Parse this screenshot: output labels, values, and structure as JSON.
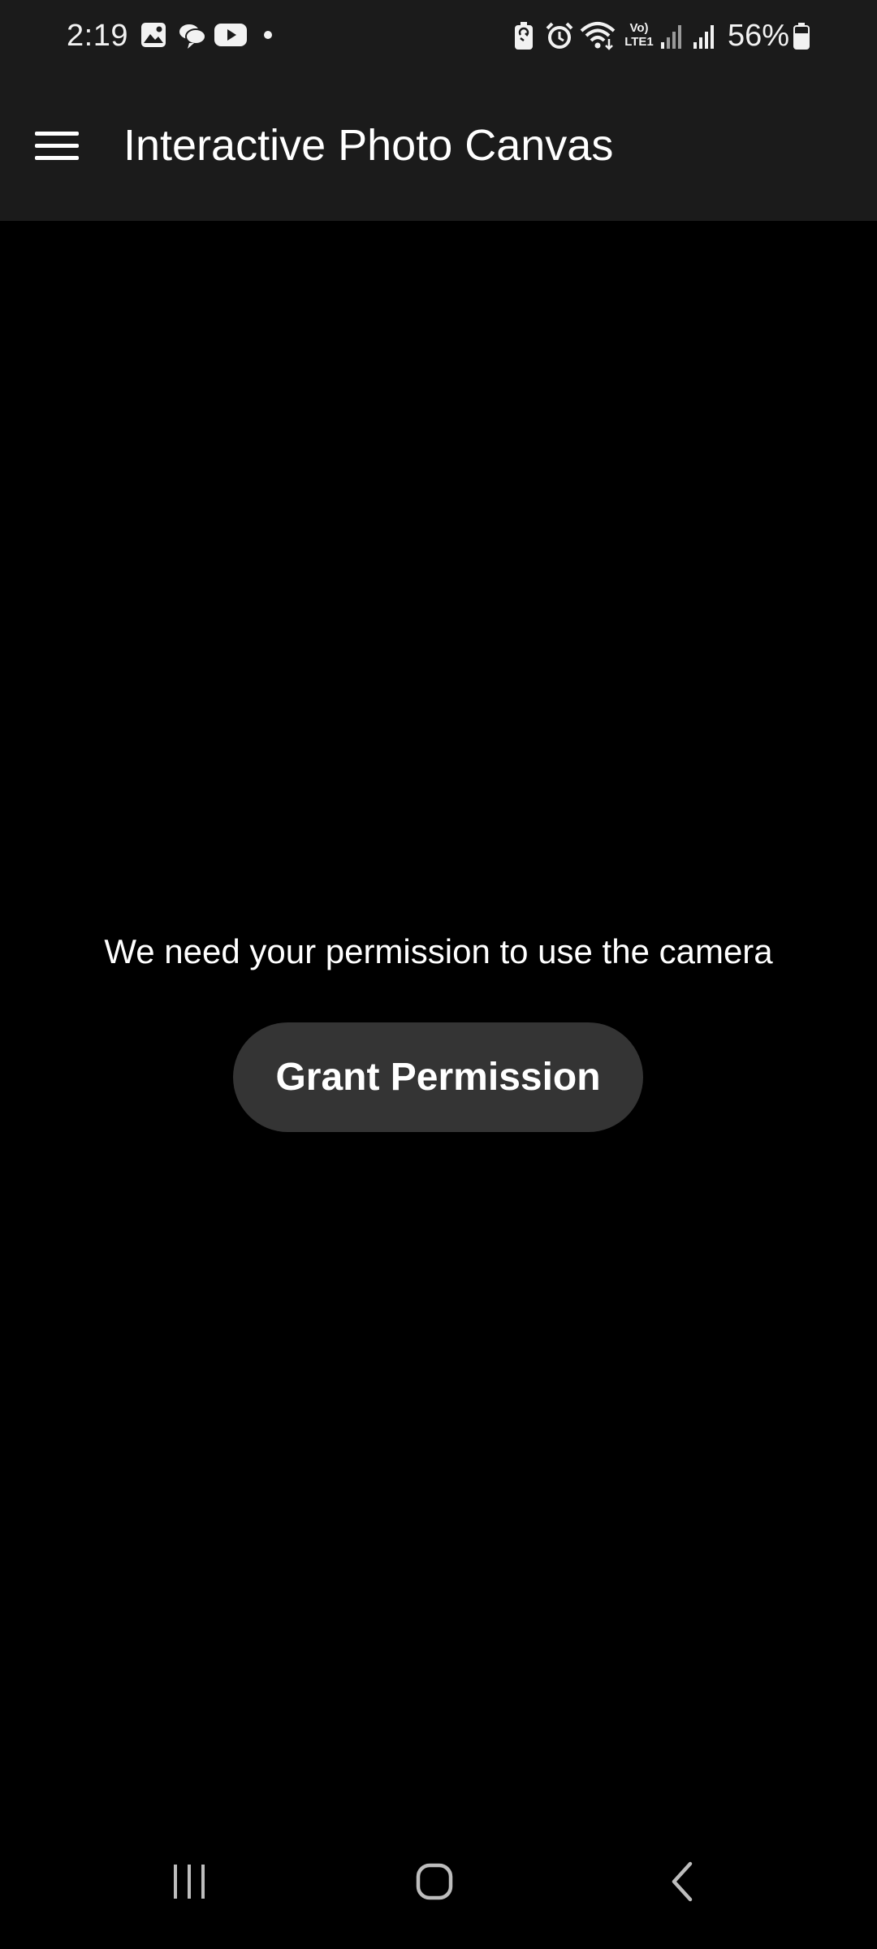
{
  "status_bar": {
    "time": "2:19",
    "battery_percent": "56%",
    "lte_label": "Vo) LTE1",
    "left_icons": [
      "gallery-icon",
      "chat-bubbles-icon",
      "youtube-icon",
      "notification-dot-icon"
    ],
    "right_icons": [
      "battery-saver-icon",
      "alarm-icon",
      "wifi-icon",
      "volte-icon",
      "signal-icon",
      "signal-icon",
      "battery-icon"
    ]
  },
  "app_bar": {
    "title": "Interactive Photo Canvas",
    "menu_icon": "hamburger-menu-icon"
  },
  "permission": {
    "message": "We need your permission to use the camera",
    "button_label": "Grant Permission"
  },
  "nav_bar": {
    "items": [
      "recent-apps-icon",
      "home-icon",
      "back-icon"
    ]
  },
  "colors": {
    "background": "#000000",
    "app_bar": "#1b1b1b",
    "button": "#343434",
    "text": "#ffffff"
  }
}
